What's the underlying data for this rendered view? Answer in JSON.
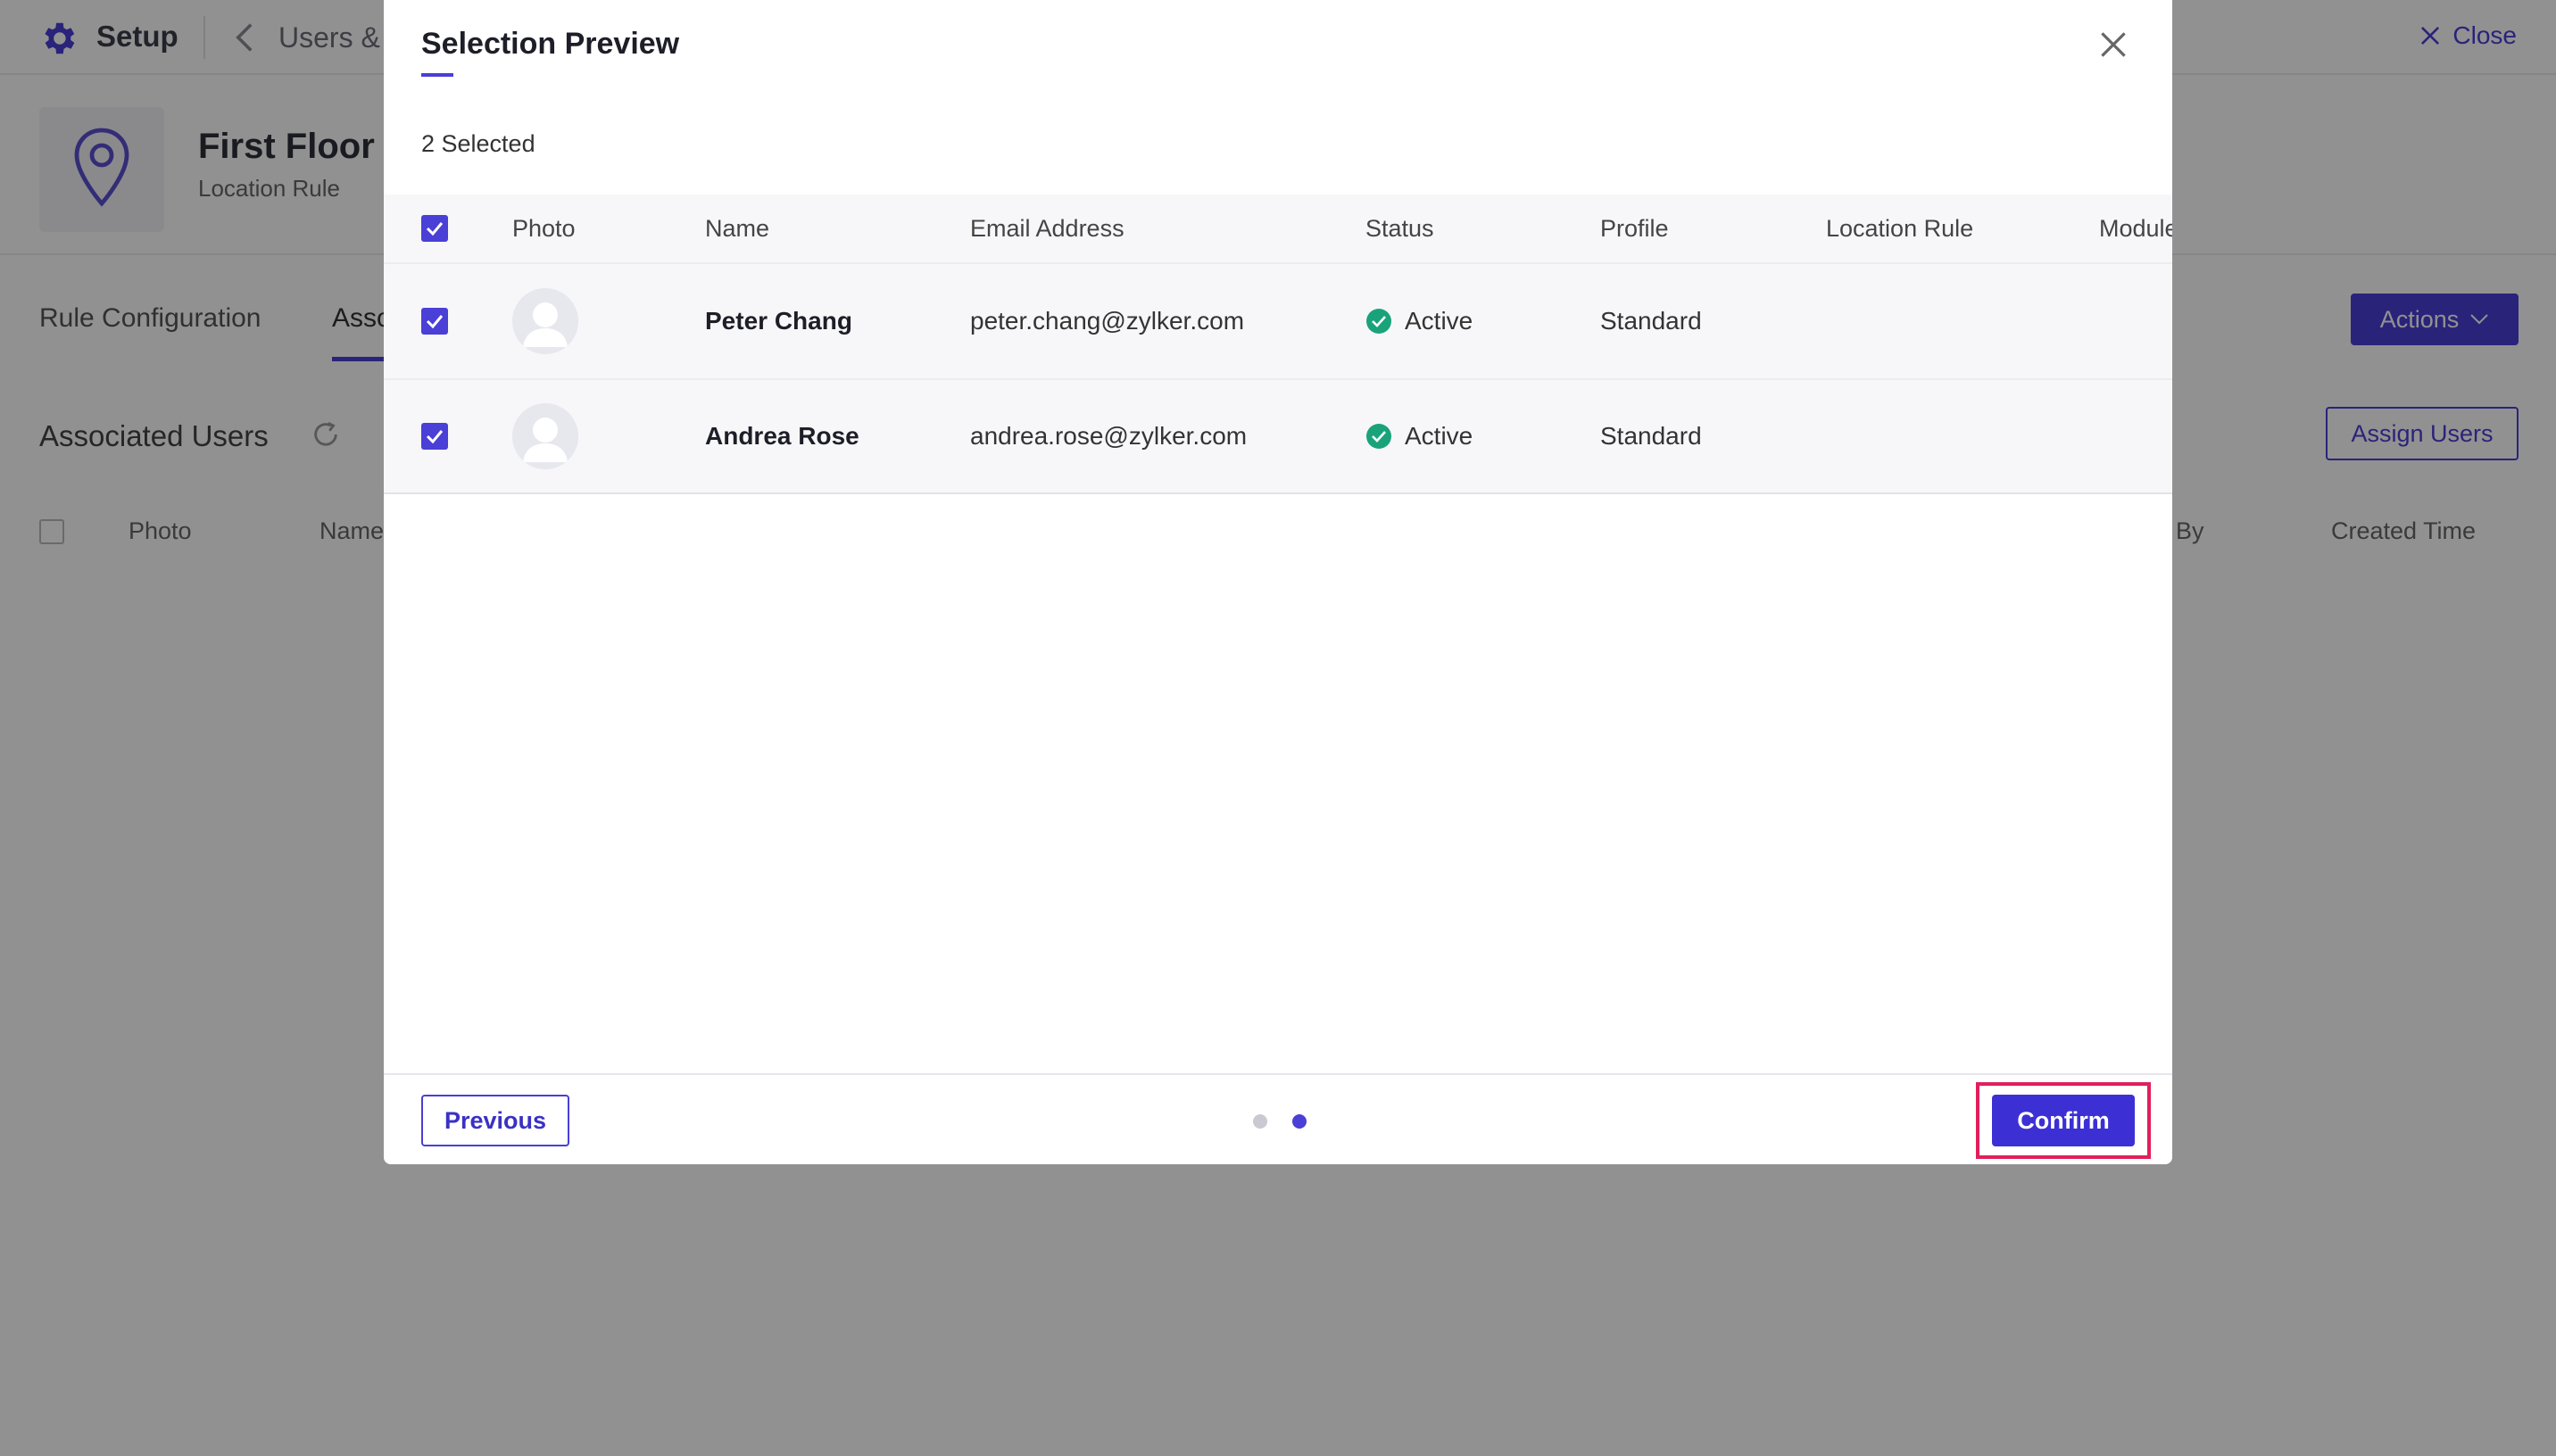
{
  "topbar": {
    "setup_label": "Setup",
    "breadcrumb": "Users &",
    "close_label": "Close"
  },
  "hero": {
    "rule_title": "First Floor F",
    "rule_subtitle": "Location Rule"
  },
  "tabs": {
    "rule_configuration": "Rule Configuration",
    "associated": "Assoc",
    "actions_label": "Actions"
  },
  "associated": {
    "title": "Associated Users",
    "assign_users_label": "Assign Users"
  },
  "background_table": {
    "headers": [
      "Photo",
      "Name",
      "By",
      "Created Time"
    ]
  },
  "modal": {
    "title": "Selection Preview",
    "selected_count": "2 Selected",
    "headers": [
      "Photo",
      "Name",
      "Email Address",
      "Status",
      "Profile",
      "Location Rule",
      "Module"
    ],
    "rows": [
      {
        "name": "Peter Chang",
        "email": "peter.chang@zylker.com",
        "status": "Active",
        "profile": "Standard"
      },
      {
        "name": "Andrea Rose",
        "email": "andrea.rose@zylker.com",
        "status": "Active",
        "profile": "Standard"
      }
    ],
    "previous_label": "Previous",
    "confirm_label": "Confirm",
    "pagination": {
      "total_steps": 2,
      "current_step": 2
    }
  },
  "colors": {
    "accent": "#4a3fd6",
    "status_active": "#1aa37a",
    "highlight": "#e0205c"
  }
}
